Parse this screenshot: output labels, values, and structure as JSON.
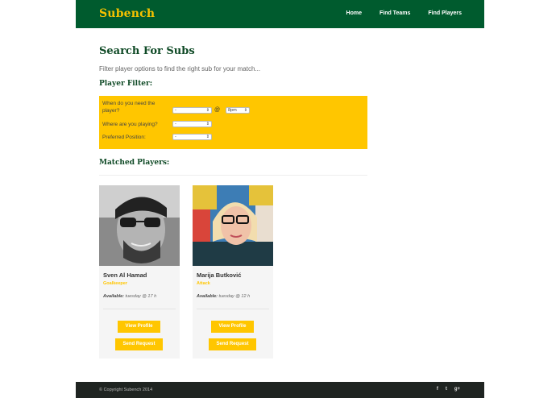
{
  "header": {
    "logo": "Subench",
    "nav": [
      "Home",
      "Find Teams",
      "Find Players"
    ]
  },
  "main": {
    "title": "Search For Subs",
    "subtitle": "Filter player options to find the right sub for your match...",
    "filter_title": "Player Filter:",
    "filter": {
      "when_label_1": "When do you need the",
      "when_label_2": "player?",
      "when_value": "-",
      "at": "@",
      "time_value": "8pm",
      "where_label": "Where are you playing?",
      "where_value": "-",
      "position_label": "Preferred Position:",
      "position_value": "-"
    },
    "matched_title": "Matched Players:",
    "players": [
      {
        "name": "Sven Al Hamad",
        "position": "Goalkeeper",
        "available_label": "Available:",
        "available_value": "tuesday @ 17 h",
        "view_label": "View Profile",
        "send_label": "Send Request"
      },
      {
        "name": "Marija Butković",
        "position": "Attack",
        "available_label": "Available:",
        "available_value": "tuesday @ 12 h",
        "view_label": "View Profile",
        "send_label": "Send Request"
      }
    ]
  },
  "footer": {
    "copyright": "© Copyright Subench 2014",
    "social": [
      "f",
      "t",
      "g+"
    ]
  },
  "colors": {
    "brand_green": "#005b2e",
    "accent_yellow": "#ffc600",
    "footer_dark": "#1f2421"
  },
  "icons": [
    "facebook-icon",
    "twitter-icon",
    "google-plus-icon",
    "chevron-down-icon"
  ]
}
